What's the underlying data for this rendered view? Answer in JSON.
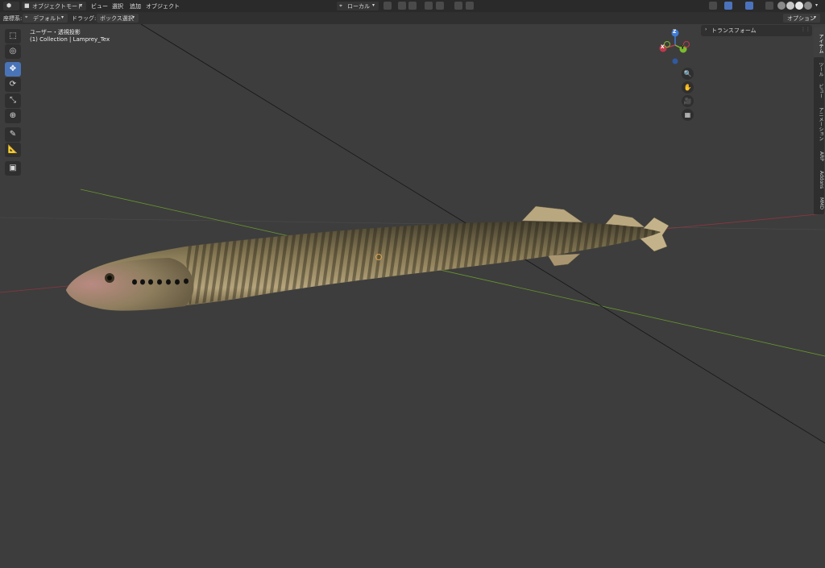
{
  "header": {
    "editor_type_icon": "3d-viewport-icon",
    "mode_label": "オブジェクトモード",
    "menus": [
      "ビュー",
      "選択",
      "追加",
      "オブジェクト"
    ],
    "transform_orientation": "ローカル",
    "options_label": "オプション"
  },
  "toolbar2": {
    "coord_label": "座標系:",
    "coord_value": "デフォルト",
    "drag_label": "ドラッグ:",
    "drag_value": "ボックス選択"
  },
  "viewport": {
    "view_name": "ユーザー・透視投影",
    "collection_info": "(1) Collection | Lamprey_Tex",
    "gizmo": {
      "z": "Z",
      "y": "Y",
      "x": "X"
    },
    "colors": {
      "x_axis": "#c0394a",
      "y_axis": "#7dbb2f",
      "z_axis": "#3f7ad6",
      "active_tool": "#4a74b8"
    }
  },
  "tools": [
    {
      "name": "select-box-icon",
      "glyph": "⬚"
    },
    {
      "name": "cursor-icon",
      "glyph": "◎"
    },
    {
      "name": "move-icon",
      "glyph": "✥",
      "active": true
    },
    {
      "name": "rotate-icon",
      "glyph": "⟳"
    },
    {
      "name": "scale-icon",
      "glyph": "⤡"
    },
    {
      "name": "transform-icon",
      "glyph": "⊕"
    },
    {
      "name": "annotate-icon",
      "glyph": "✎"
    },
    {
      "name": "measure-icon",
      "glyph": "📐"
    },
    {
      "name": "add-cube-icon",
      "glyph": "▣"
    }
  ],
  "nav_buttons": [
    {
      "name": "zoom-icon",
      "glyph": "🔍"
    },
    {
      "name": "pan-hand-icon",
      "glyph": "✋"
    },
    {
      "name": "camera-icon",
      "glyph": "🎥"
    },
    {
      "name": "grid-icon",
      "glyph": "▦"
    }
  ],
  "sidebar": {
    "panel_title": "トランスフォーム",
    "tabs": [
      "アイテム",
      "ツール",
      "ビュー",
      "アニメーション",
      "ARP",
      "Addons",
      "MMD"
    ]
  }
}
